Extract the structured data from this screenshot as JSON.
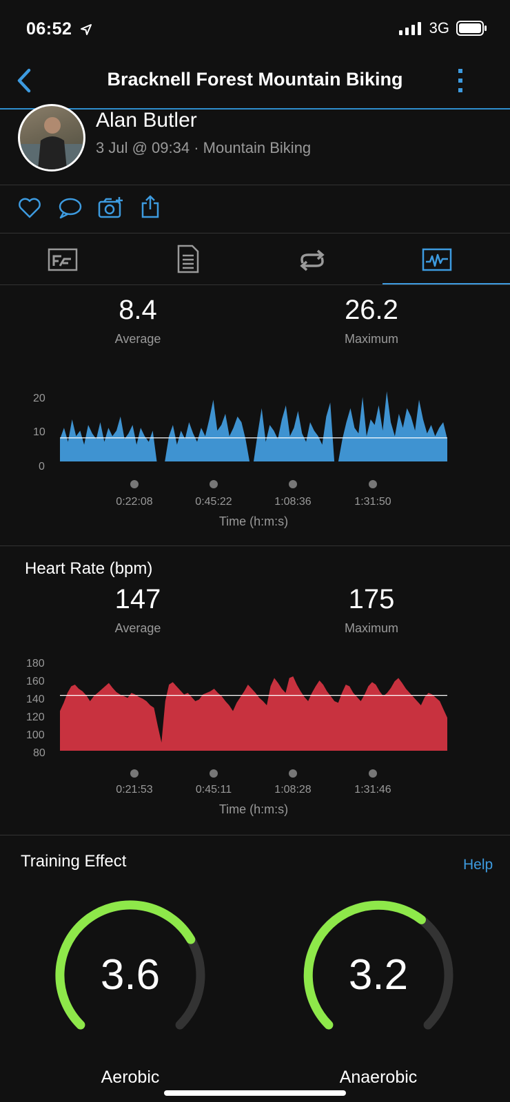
{
  "status_bar": {
    "time": "06:52",
    "network": "3G"
  },
  "nav": {
    "title": "Bracknell Forest Mountain Biking"
  },
  "activity": {
    "user_name": "Alan Butler",
    "meta": "3 Jul @ 09:34 · Mountain Biking"
  },
  "speed_summary": {
    "average_value": "8.4",
    "average_label": "Average",
    "maximum_value": "26.2",
    "maximum_label": "Maximum"
  },
  "heart_rate": {
    "title": "Heart Rate (bpm)",
    "average_value": "147",
    "average_label": "Average",
    "maximum_value": "175",
    "maximum_label": "Maximum"
  },
  "training_effect": {
    "title": "Training Effect",
    "help_label": "Help",
    "aerobic_value": "3.6",
    "aerobic_label": "Aerobic",
    "anaerobic_value": "3.2",
    "anaerobic_label": "Anaerobic"
  },
  "colors": {
    "accent": "#3d9be0",
    "speed": "#3f93d1",
    "heart": "#c8323f",
    "gauge_active": "#8ee84a",
    "gauge_track": "#333333"
  },
  "chart_data": [
    {
      "type": "area",
      "x_ticks": [
        "0:22:08",
        "0:45:22",
        "1:08:36",
        "1:31:50"
      ],
      "y_ticks": [
        "20",
        "10",
        "0"
      ],
      "xlabel": "Time (h:m:s)",
      "ylim": [
        0,
        27
      ],
      "average_line": 8.4,
      "series": [
        {
          "values": [
            8,
            12,
            7,
            15,
            9,
            11,
            6,
            13,
            10,
            8,
            14,
            7,
            12,
            9,
            11,
            16,
            8,
            10,
            13,
            6,
            12,
            9,
            7,
            11,
            0,
            0,
            0,
            9,
            13,
            6,
            11,
            8,
            14,
            10,
            7,
            12,
            9,
            15,
            22,
            11,
            13,
            17,
            9,
            12,
            16,
            14,
            8,
            0,
            0,
            10,
            19,
            7,
            13,
            11,
            8,
            15,
            20,
            9,
            12,
            18,
            10,
            7,
            14,
            11,
            9,
            6,
            16,
            21,
            0,
            0,
            8,
            14,
            19,
            12,
            10,
            23,
            9,
            15,
            13,
            20,
            11,
            25,
            14,
            9,
            17,
            12,
            19,
            16,
            11,
            22,
            15,
            10,
            13,
            9,
            12,
            14,
            8
          ]
        }
      ]
    },
    {
      "type": "area",
      "title": "Heart Rate (bpm)",
      "x_ticks": [
        "0:21:53",
        "0:45:11",
        "1:08:28",
        "1:31:46"
      ],
      "y_ticks": [
        "180",
        "160",
        "140",
        "120",
        "100",
        "80"
      ],
      "xlabel": "Time (h:m:s)",
      "ylim": [
        80,
        180
      ],
      "average_line": 147,
      "series": [
        {
          "values": [
            128,
            138,
            150,
            158,
            160,
            155,
            152,
            147,
            140,
            146,
            150,
            154,
            158,
            162,
            156,
            151,
            148,
            146,
            144,
            150,
            148,
            145,
            143,
            140,
            135,
            132,
            110,
            90,
            140,
            160,
            163,
            158,
            153,
            148,
            150,
            145,
            140,
            142,
            148,
            150,
            152,
            155,
            150,
            146,
            140,
            135,
            128,
            138,
            145,
            152,
            160,
            155,
            150,
            144,
            140,
            135,
            158,
            168,
            162,
            155,
            150,
            168,
            170,
            160,
            152,
            145,
            140,
            150,
            158,
            165,
            160,
            152,
            146,
            140,
            138,
            150,
            160,
            158,
            150,
            145,
            140,
            148,
            158,
            163,
            160,
            152,
            146,
            150,
            156,
            164,
            168,
            162,
            155,
            150,
            145,
            140,
            135,
            145,
            150,
            148,
            144,
            140,
            130,
            120
          ]
        }
      ]
    }
  ]
}
